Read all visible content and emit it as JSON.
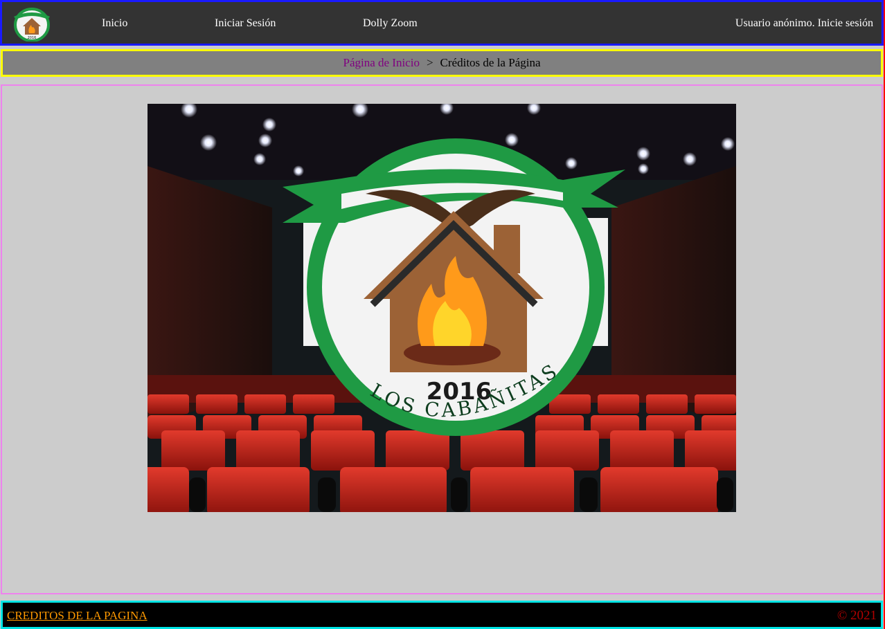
{
  "header": {
    "logo_year": "2016",
    "nav": [
      {
        "label": "Inicio"
      },
      {
        "label": "Iniciar Sesión"
      },
      {
        "label": "Dolly Zoom"
      }
    ],
    "user_status": "Usuario anónimo. Inicie sesión"
  },
  "breadcrumb": {
    "home_label": "Página de Inicio",
    "separator": ">",
    "current": "Créditos de la Página"
  },
  "main": {
    "hero_logo_year": "2016",
    "hero_logo_text": "LOS CABAÑITAS"
  },
  "footer": {
    "credits_link": "CREDITOS DE LA PAGINA",
    "copyright": "© 2021"
  },
  "colors": {
    "header_bg": "#333333",
    "header_border": "#1a1aff",
    "breadcrumb_border": "#ffff00",
    "main_border": "#ee82ee",
    "footer_border": "#00e5e5",
    "footer_link": "#ff9900",
    "copyright": "#b30000",
    "logo_green": "#1f9a44"
  }
}
